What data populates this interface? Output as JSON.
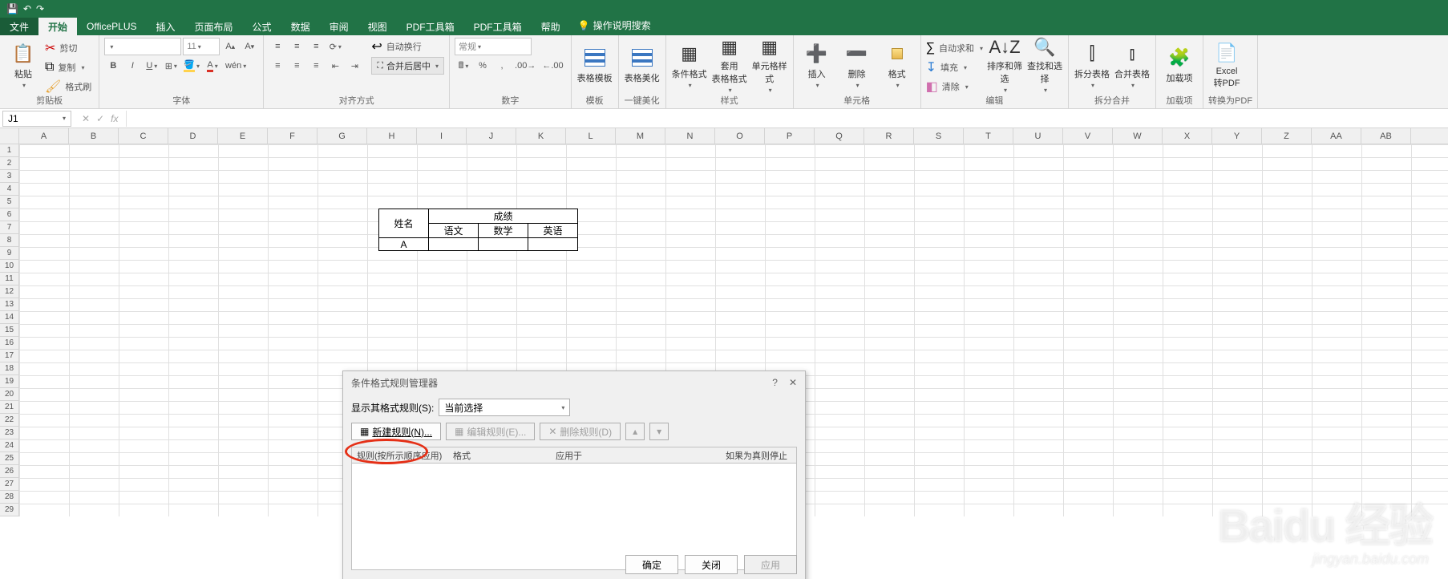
{
  "tabs": {
    "file": "文件",
    "home": "开始",
    "officeplus": "OfficePLUS",
    "insert": "插入",
    "layout": "页面布局",
    "formulas": "公式",
    "data": "数据",
    "review": "审阅",
    "view": "视图",
    "pdf1": "PDF工具箱",
    "pdf2": "PDF工具箱",
    "help": "帮助",
    "tellme": "操作说明搜索"
  },
  "ribbon": {
    "clipboard": {
      "title": "剪贴板",
      "paste": "粘贴",
      "cut": "剪切",
      "copy": "复制",
      "painter": "格式刷"
    },
    "font": {
      "title": "字体",
      "name_ph": "",
      "size_ph": "11"
    },
    "align": {
      "title": "对齐方式",
      "wrap": "自动换行",
      "merge": "合并后居中"
    },
    "number": {
      "title": "数字",
      "format_ph": "常规"
    },
    "template": {
      "title": "模板",
      "btn": "表格模板"
    },
    "beautify": {
      "title": "一键美化",
      "btn": "表格美化"
    },
    "styles": {
      "title": "样式",
      "cond": "条件格式",
      "ftable": "套用\n表格格式",
      "cell": "单元格样式"
    },
    "cells": {
      "title": "单元格",
      "insert": "插入",
      "delete": "删除",
      "format": "格式"
    },
    "editing": {
      "title": "编辑",
      "sum": "自动求和",
      "fill": "填充",
      "clear": "清除",
      "sort": "排序和筛选",
      "find": "查找和选择"
    },
    "split": {
      "title": "拆分合并",
      "splitbtn": "拆分表格",
      "mergebtn": "合并表格"
    },
    "addin": {
      "title": "加载项",
      "btn": "加载项"
    },
    "pdf": {
      "title": "转换为PDF",
      "btn": "Excel\n转PDF"
    }
  },
  "formula_bar": {
    "name": "J1"
  },
  "columns": [
    "A",
    "B",
    "C",
    "D",
    "E",
    "F",
    "G",
    "H",
    "I",
    "J",
    "K",
    "L",
    "M",
    "N",
    "O",
    "P",
    "Q",
    "R",
    "S",
    "T",
    "U",
    "V",
    "W",
    "X",
    "Y",
    "Z",
    "AA",
    "AB"
  ],
  "row_count": 29,
  "table": {
    "name": "姓名",
    "score": "成绩",
    "chinese": "语文",
    "math": "数学",
    "english": "英语",
    "rowA": "A"
  },
  "dialog": {
    "title": "条件格式规则管理器",
    "show_label": "显示其格式规则(S):",
    "show_value": "当前选择",
    "new_rule": "新建规则(N)...",
    "edit_rule": "编辑规则(E)...",
    "del_rule": "删除规则(D)",
    "col_rule": "规则(按所示顺序应用)",
    "col_format": "格式",
    "col_applies": "应用于",
    "col_stop": "如果为真则停止",
    "ok": "确定",
    "close": "关闭",
    "apply": "应用"
  },
  "watermark": {
    "main": "Baidu 经验",
    "sub": "jingyan.baidu.com"
  }
}
